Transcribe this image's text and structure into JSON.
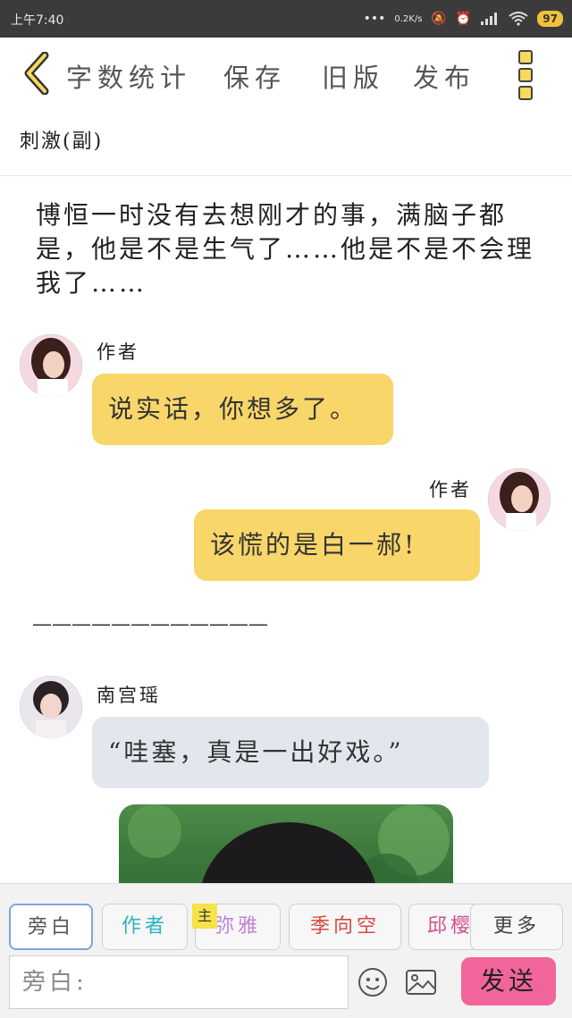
{
  "status": {
    "time": "上午7:40",
    "net": "0.2K/s",
    "battery": "97"
  },
  "toolbar": {
    "word_count": "字数统计",
    "save": "保存",
    "old_version": "旧版",
    "publish": "发布"
  },
  "chapter": {
    "title": "刺激(副)"
  },
  "narration": "博恒一时没有去想刚才的事，满脑子都是，他是不是生气了……他是不是不会理我了……",
  "messages": [
    {
      "speaker": "作者",
      "text": "说实话，你想多了。"
    },
    {
      "speaker": "作者",
      "text": "该慌的是白一郝!"
    },
    {
      "speaker": "南宫瑶",
      "text": "“哇塞，真是一出好戏。”"
    }
  ],
  "divider": "————————————",
  "roles": [
    "旁白",
    "作者",
    "弥雅",
    "季向空",
    "邱樱"
  ],
  "role_colors": [
    "#555555",
    "#2bb3c0",
    "#c080d8",
    "#d64a3f",
    "#d04e8c"
  ],
  "main_badge": "主",
  "more_roles": "更多",
  "input": {
    "placeholder": "旁白:"
  },
  "send_label": "发送",
  "colors": {
    "accent_yellow": "#f8d66a",
    "bubble_grey": "#e2e7ee",
    "send_pink": "#f2659c"
  }
}
